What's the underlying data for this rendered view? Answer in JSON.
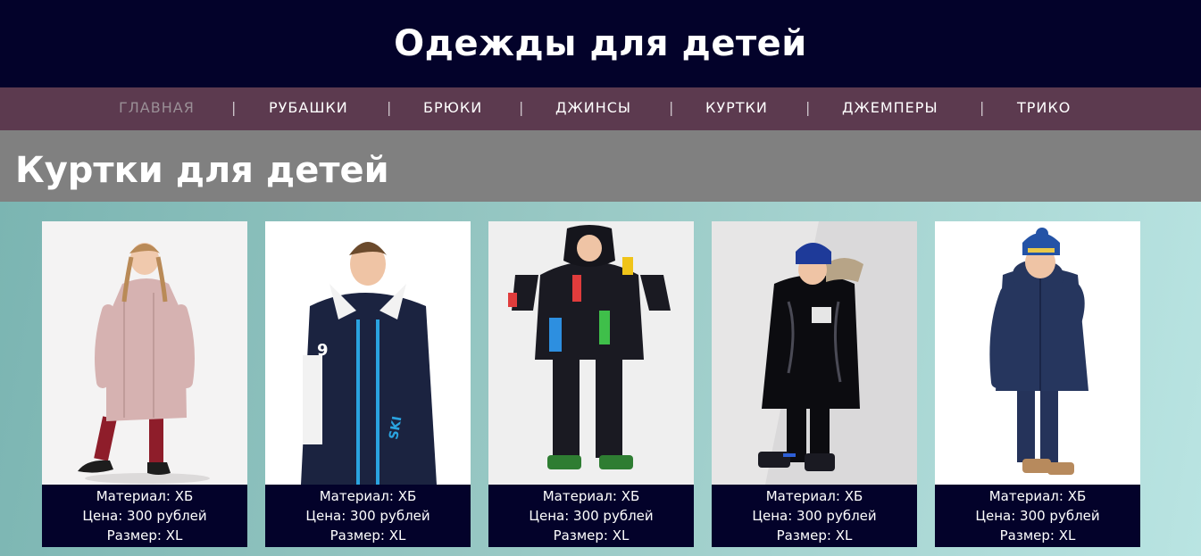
{
  "header": {
    "title": "Одежды для детей"
  },
  "nav": {
    "items": [
      {
        "label": "ГЛАВНАЯ",
        "active": true
      },
      {
        "label": "РУБАШКИ",
        "active": false
      },
      {
        "label": "БРЮКИ",
        "active": false
      },
      {
        "label": "ДЖИНСЫ",
        "active": false
      },
      {
        "label": "КУРТКИ",
        "active": false
      },
      {
        "label": "ДЖЕМПЕРЫ",
        "active": false
      },
      {
        "label": "ТРИКО",
        "active": false
      }
    ],
    "separator": "|"
  },
  "section": {
    "title": "Куртки для детей"
  },
  "products": [
    {
      "image": "girl-pink-coat-photo",
      "material": "Материал: ХБ",
      "price": "Цена: 300 рублей",
      "size": "Размер: XL",
      "jacket_color": "#d9b5b3"
    },
    {
      "image": "boy-navy-ski-jacket-photo",
      "material": "Материал: ХБ",
      "price": "Цена: 300 рублей",
      "size": "Размер: XL",
      "jacket_color": "#1b2340"
    },
    {
      "image": "boy-black-snowsuit-photo",
      "material": "Материал: ХБ",
      "price": "Цена: 300 рублей",
      "size": "Размер: XL",
      "jacket_color": "#1a1a22"
    },
    {
      "image": "boy-black-puffer-photo",
      "material": "Материал: ХБ",
      "price": "Цена: 300 рублей",
      "size": "Размер: XL",
      "jacket_color": "#0c0c10"
    },
    {
      "image": "boy-navy-parka-photo",
      "material": "Материал: ХБ",
      "price": "Цена: 300 рублей",
      "size": "Размер: XL",
      "jacket_color": "#26365e"
    }
  ],
  "colors": {
    "header_bg": "#03022a",
    "nav_bg": "#5c3a4f",
    "section_bg": "#808080",
    "info_bg": "#03022a"
  }
}
